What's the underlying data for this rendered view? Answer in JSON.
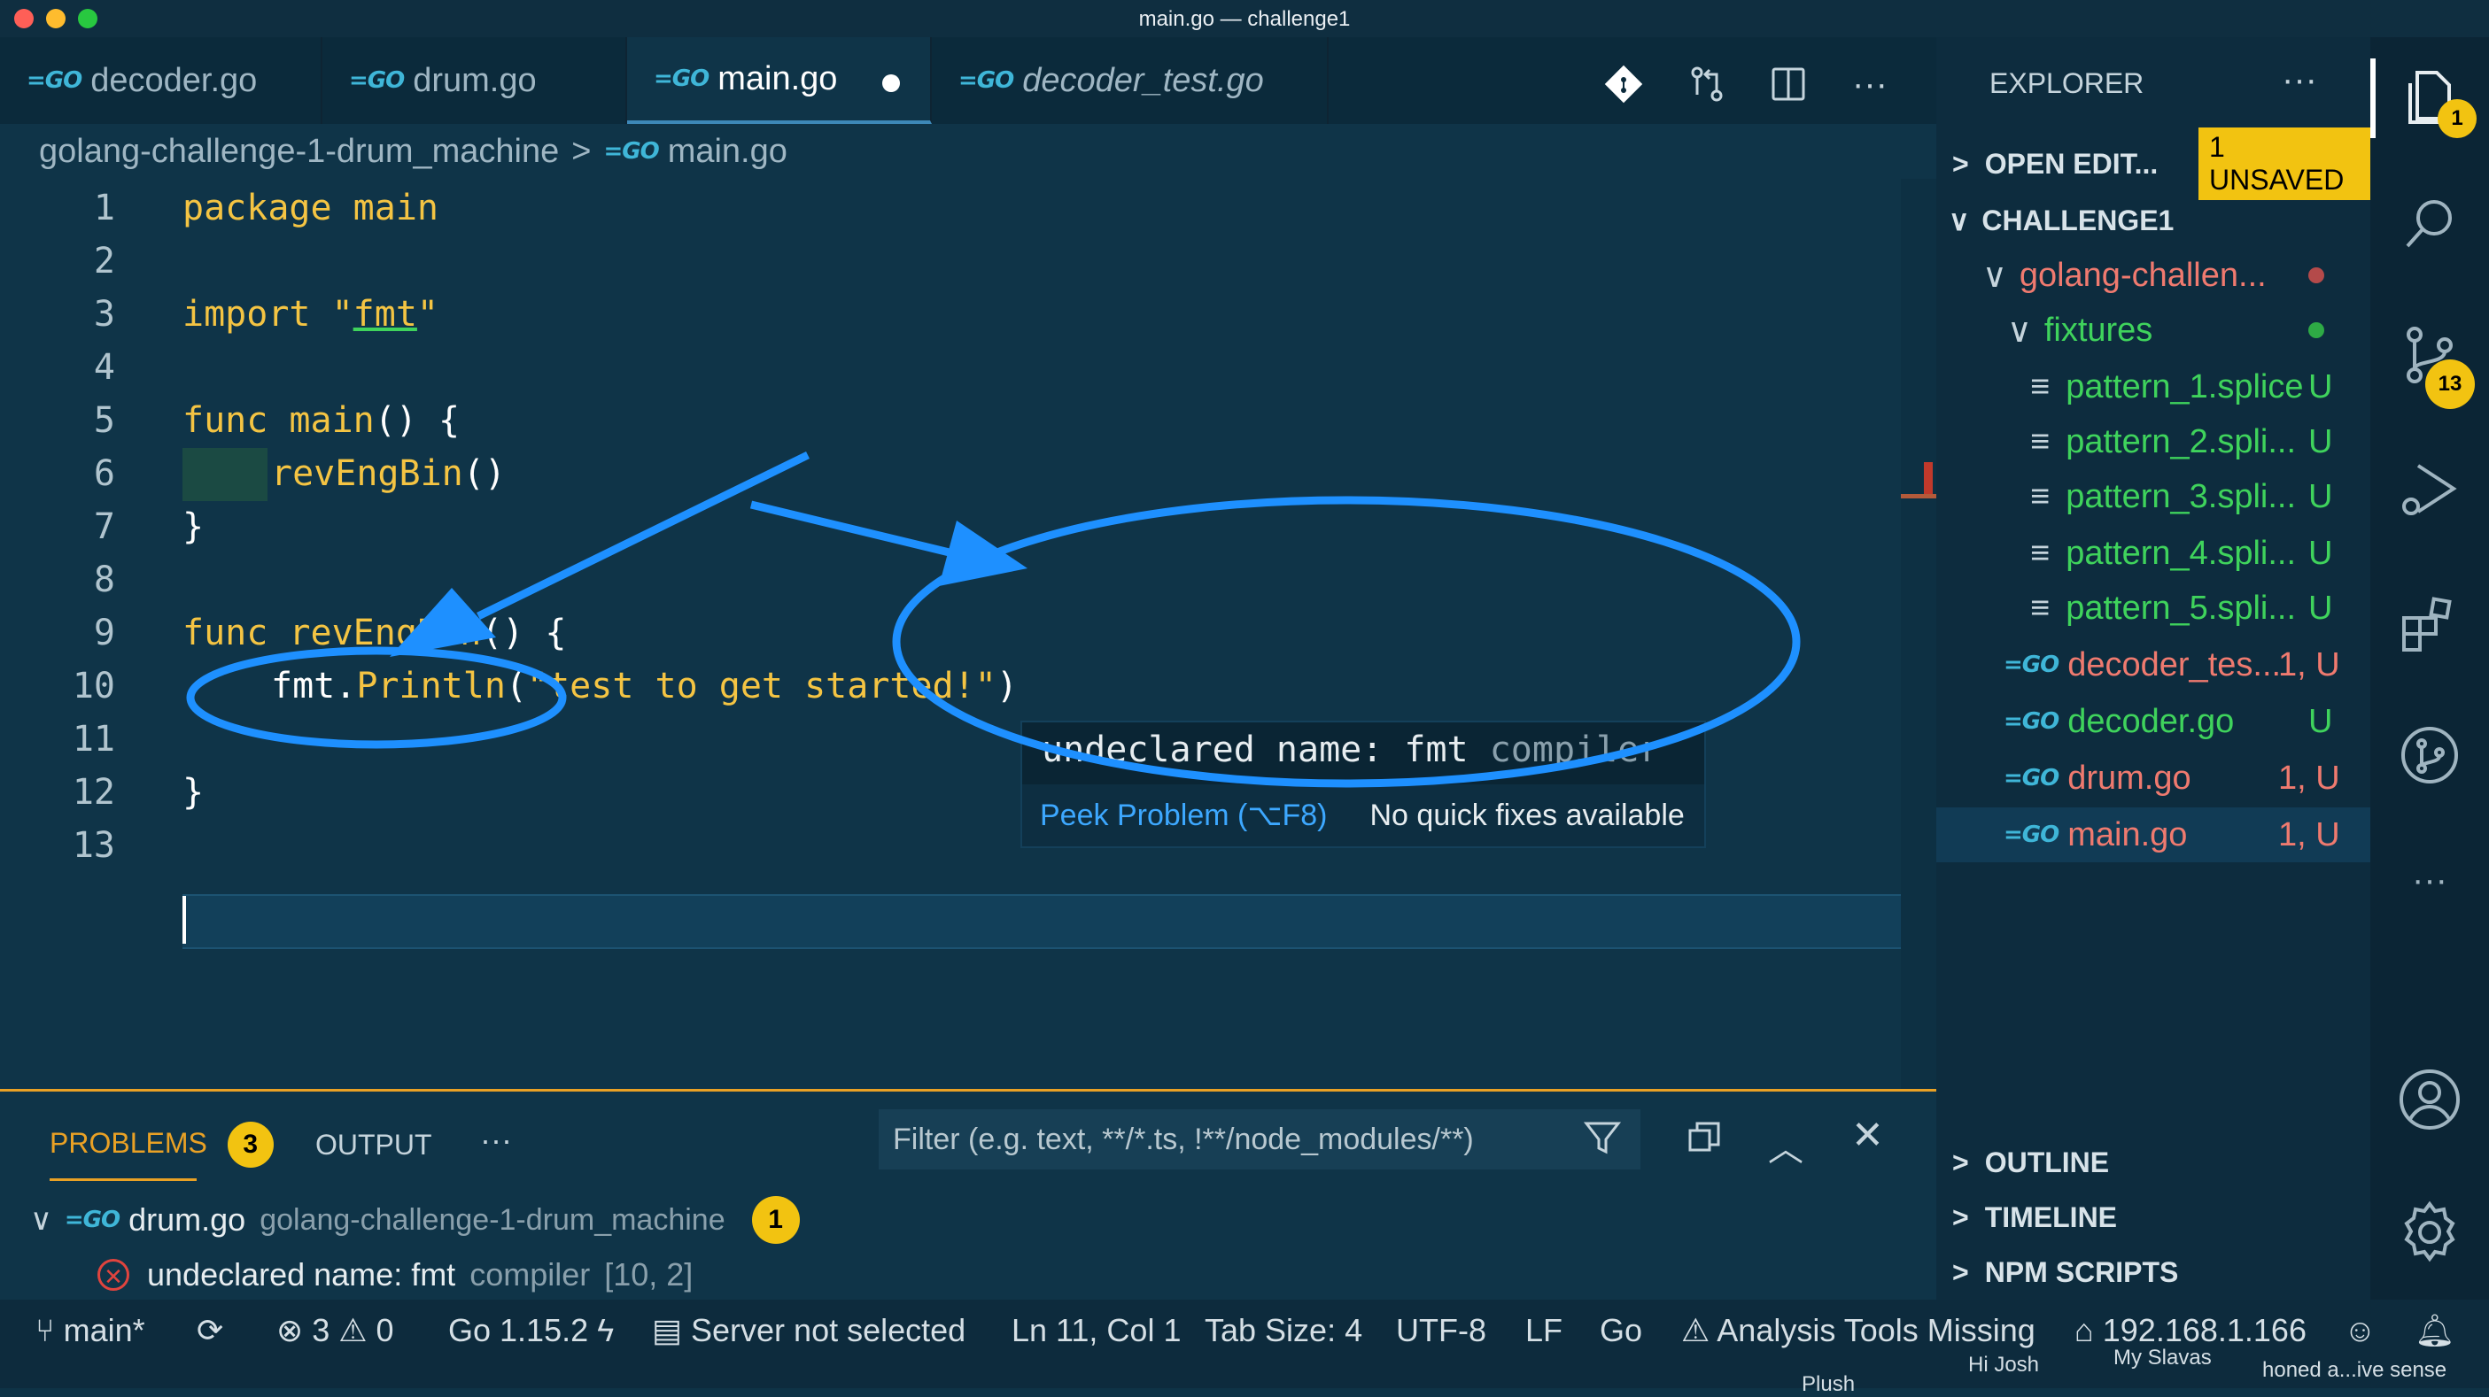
{
  "window": {
    "title": "main.go — challenge1"
  },
  "tabs": [
    {
      "label": "decoder.go",
      "icon": "go-file-icon"
    },
    {
      "label": "drum.go",
      "icon": "go-file-icon"
    },
    {
      "label": "main.go",
      "icon": "go-file-icon",
      "active": true,
      "dirty": true
    },
    {
      "label": "decoder_test.go",
      "icon": "go-file-icon",
      "italic": true
    }
  ],
  "breadcrumb": {
    "folder": "golang-challenge-1-drum_machine",
    "file": "main.go"
  },
  "editor": {
    "lines": [
      "1",
      "2",
      "3",
      "4",
      "5",
      "6",
      "7",
      "8",
      "9",
      "10",
      "11",
      "12",
      "13"
    ],
    "code": {
      "l1_kw": "package",
      "l1_rest": " main",
      "l3_kw": "import",
      "l3_q1": " \"",
      "l3_pkg": "fmt",
      "l3_q2": "\"",
      "l5_kw": "func",
      "l5_fn": " main",
      "l5_rest": "() {",
      "l6_fn": "revEngBin",
      "l6_rest": "()",
      "l7": "}",
      "l9_kw": "func",
      "l9_fn": " revEngBin",
      "l9_rest": "() {",
      "l10_obj": "fmt.",
      "l10_fn": "Println",
      "l10_open": "(",
      "l10_str": "\"test to get started!\"",
      "l10_close": ")",
      "l12": "}"
    },
    "hover": {
      "message": "undeclared name: fmt",
      "source": " compiler",
      "peek": "Peek Problem (⌥F8)",
      "no_fix": "No quick fixes available"
    }
  },
  "panel": {
    "tabs": {
      "problems": "PROBLEMS",
      "problems_count": "3",
      "output": "OUTPUT",
      "more": "···"
    },
    "filter_placeholder": "Filter (e.g. text, **/*.ts, !**/node_modules/**)",
    "group": {
      "file": "drum.go",
      "path": "golang-challenge-1-drum_machine",
      "count": "1"
    },
    "problem": {
      "message": "undeclared name: fmt",
      "source": "compiler",
      "location": "[10, 2]"
    }
  },
  "sidebar": {
    "title": "EXPLORER",
    "more": "···",
    "open_editors": "OPEN EDIT...",
    "unsaved": "1 UNSAVED",
    "root": "CHALLENGE1",
    "folder": "golang-challen...",
    "subfolder": "fixtures",
    "files": [
      {
        "name": "pattern_1.splice",
        "status": "U"
      },
      {
        "name": "pattern_2.spli...",
        "status": "U"
      },
      {
        "name": "pattern_3.spli...",
        "status": "U"
      },
      {
        "name": "pattern_4.spli...",
        "status": "U"
      },
      {
        "name": "pattern_5.spli...",
        "status": "U"
      }
    ],
    "gofiles": [
      {
        "name": "decoder_tes...",
        "status": "1, U"
      },
      {
        "name": "decoder.go",
        "status": "U"
      },
      {
        "name": "drum.go",
        "status": "1, U"
      },
      {
        "name": "main.go",
        "status": "1, U"
      }
    ],
    "outline": "OUTLINE",
    "timeline": "TIMELINE",
    "npm": "NPM SCRIPTS"
  },
  "activity": {
    "explorer_badge": "1",
    "scm_badge": "13"
  },
  "status": {
    "branch": "main*",
    "errors": "3",
    "warnings": "0",
    "go_version": "Go 1.15.2",
    "server": "Server not selected",
    "position": "Ln 11, Col 1",
    "tab_size": "Tab Size: 4",
    "encoding": "UTF-8",
    "eol": "LF",
    "language": "Go",
    "analysis": "Analysis Tools Missing",
    "ip": "192.168.1.166",
    "overlay1": "Plush",
    "overlay2": "Hi Josh",
    "overlay3": "My Slavas",
    "overlay4": "honed a...ive sense"
  },
  "colors": {
    "accent": "#1e90ff",
    "badge": "#f2c311",
    "untracked": "#3fd35c",
    "error": "#ef7a6f"
  }
}
